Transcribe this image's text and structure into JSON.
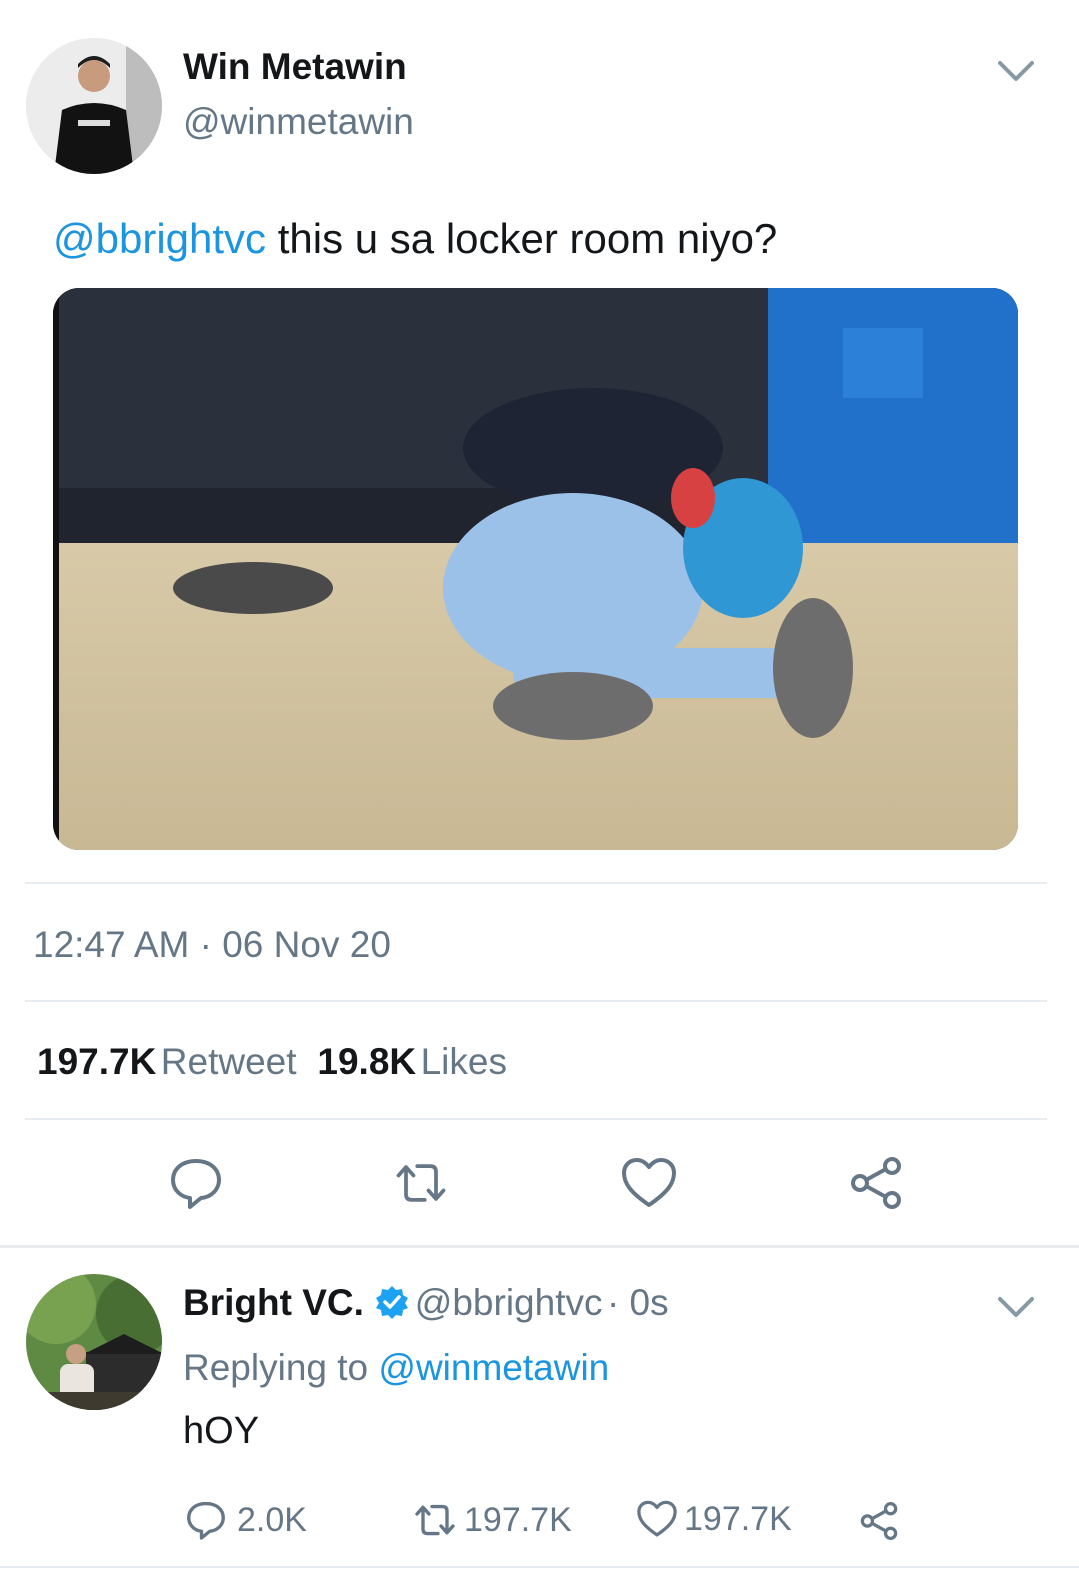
{
  "tweet": {
    "author_name": "Win Metawin",
    "author_handle": "@winmetawin",
    "mention": "@bbrightvc",
    "text": " this u sa locker room niyo?",
    "time": "12:47 AM",
    "separator": "·",
    "date": "06 Nov 20",
    "retweet_count": "197.7K",
    "retweet_label": "Retweet",
    "like_count": "19.8K",
    "like_label": "Likes"
  },
  "reply": {
    "author_name": "Bright VC.",
    "author_handle": "@bbrightvc",
    "age": "· 0s",
    "replying_prefix": "Replying to",
    "replying_to": "@winmetawin",
    "text": "hOY",
    "reply_count": "2.0K",
    "retweet_count": "197.7K",
    "like_count": "197.7K"
  },
  "icons": [
    "chevron-down-icon",
    "reply-icon",
    "retweet-icon",
    "heart-icon",
    "share-icon",
    "verified-badge-icon"
  ],
  "colors": {
    "accent": "#1b95e0",
    "muted": "#657786",
    "text": "#14171a",
    "divider": "#e6ecf0"
  }
}
